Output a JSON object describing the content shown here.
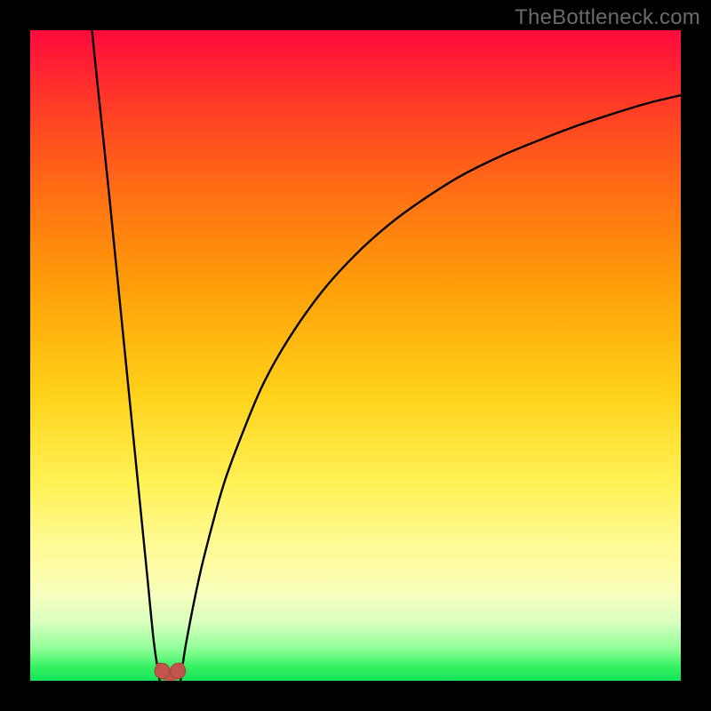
{
  "watermark": "TheBottleneck.com",
  "colors": {
    "frame": "#000000",
    "curve": "#000000",
    "marker_fill": "#c1564c",
    "marker_stroke": "#a8463c"
  },
  "chart_data": {
    "type": "line",
    "title": "",
    "xlabel": "",
    "ylabel": "",
    "xlim": [
      0,
      100
    ],
    "ylim": [
      0,
      100
    ],
    "grid": false,
    "legend": false,
    "annotations": [],
    "series": [
      {
        "name": "left-branch",
        "x": [
          9.5,
          10,
          11,
          12,
          13,
          14,
          15,
          16,
          17,
          18,
          19,
          19.9
        ],
        "y": [
          100,
          95,
          85.5,
          76,
          66,
          56,
          46,
          36,
          26,
          16,
          6,
          0
        ]
      },
      {
        "name": "right-branch",
        "x": [
          23.1,
          24,
          26,
          28,
          30,
          33,
          36,
          40,
          45,
          50,
          55,
          60,
          66,
          72,
          78,
          84,
          90,
          95,
          100
        ],
        "y": [
          0,
          6,
          16,
          24,
          31,
          39,
          46,
          53,
          60,
          65.5,
          70,
          73.7,
          77.5,
          80.5,
          83,
          85.3,
          87.3,
          88.8,
          90
        ]
      }
    ],
    "markers": [
      {
        "name": "min-marker-left",
        "x": 20.3,
        "y": 1.5
      },
      {
        "name": "min-marker-right",
        "x": 22.7,
        "y": 1.5
      }
    ],
    "min_band": {
      "x_start": 19.9,
      "x_end": 23.1,
      "y": 0.6
    }
  }
}
